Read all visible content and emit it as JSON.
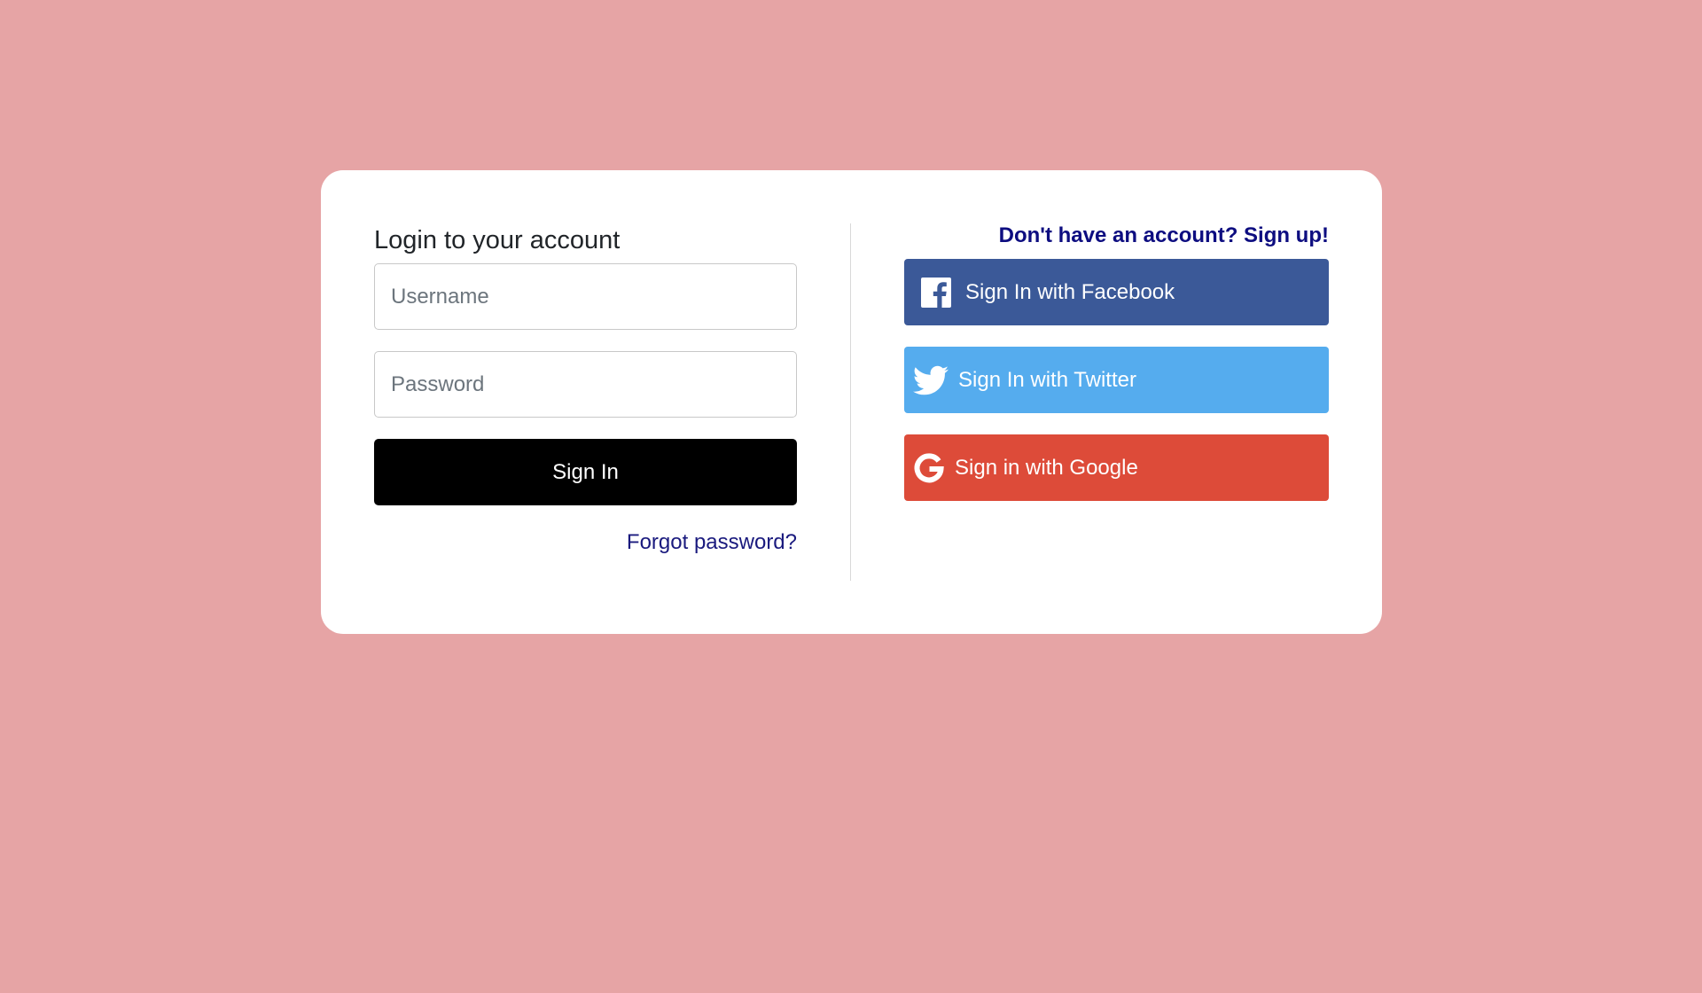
{
  "login": {
    "title": "Login to your account",
    "username_placeholder": "Username",
    "password_placeholder": "Password",
    "signin_label": "Sign In",
    "forgot_label": "Forgot password?"
  },
  "social": {
    "signup_label": "Don't have an account? Sign up!",
    "facebook_label": "Sign In with Facebook",
    "twitter_label": "Sign In with Twitter",
    "google_label": "Sign in with Google"
  },
  "colors": {
    "background": "#e6a4a5",
    "facebook": "#3b5998",
    "twitter": "#55acee",
    "google": "#dd4b39",
    "link": "#1a1a7e"
  }
}
